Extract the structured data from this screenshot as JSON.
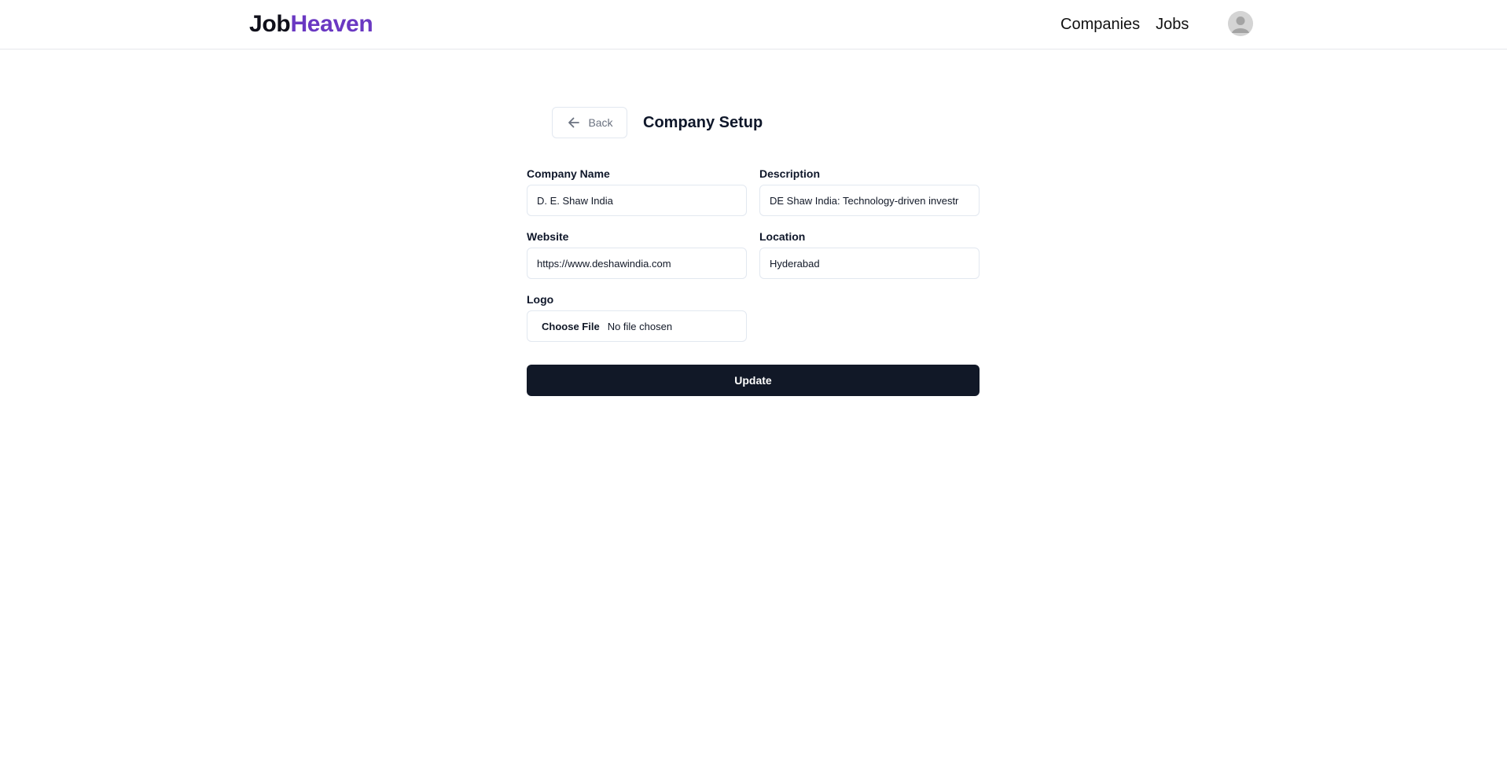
{
  "brand": {
    "part1": "Job",
    "part2": "Heaven",
    "accent_color": "#6a38c2"
  },
  "nav": {
    "links": [
      "Companies",
      "Jobs"
    ],
    "avatar_icon": "user-avatar-icon"
  },
  "setup": {
    "back_label": "Back",
    "back_icon": "arrow-left-icon",
    "title": "Company Setup"
  },
  "form": {
    "company_name": {
      "label": "Company Name",
      "value": "D. E. Shaw India"
    },
    "description": {
      "label": "Description",
      "value": "DE Shaw India: Technology-driven investr"
    },
    "website": {
      "label": "Website",
      "value": "https://www.deshawindia.com"
    },
    "location": {
      "label": "Location",
      "value": "Hyderabad"
    },
    "logo": {
      "label": "Logo",
      "button": "Choose File",
      "status": "No file chosen"
    },
    "submit_label": "Update",
    "submit_color": "#111827"
  }
}
